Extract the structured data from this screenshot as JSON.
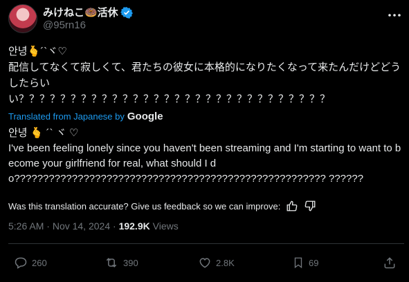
{
  "author": {
    "display_name": "みけねこ🍩活休",
    "handle": "@95rn16"
  },
  "tweet": {
    "original_text": "안녕🫰´`ヾ♡\n配信してなくて寂しくて、君たちの彼女に本格的になりたくなって来たんだけどどうしたらい\nい？？？？？？？？？？？？？？？？？？？？？？？？？？？？？？",
    "translated_label": "Translated from Japanese by",
    "translated_brand": "Google",
    "translated_text": "안녕 🫰 ´` ヾ ♡\nI've been feeling lonely since you haven't been streaming and I'm starting to want to become your girlfriend for real, what should I do?????????????????????????????????????????????????????? ??????",
    "feedback_prompt": "Was this translation accurate? Give us feedback so we can improve:",
    "time": "5:26 AM",
    "date": "Nov 14, 2024",
    "separator": "·",
    "views_count": "192.9K",
    "views_label": "Views"
  },
  "actions": {
    "replies": "260",
    "reposts": "390",
    "likes": "2.8K",
    "bookmarks": "69"
  },
  "colors": {
    "background": "#000000",
    "text": "#e7e9ea",
    "muted": "#71767b",
    "link": "#1d9bf0",
    "divider": "#2f3336"
  },
  "icons": [
    "verified-badge-icon",
    "more-icon",
    "thumbs-up-icon",
    "thumbs-down-icon",
    "reply-icon",
    "repost-icon",
    "like-icon",
    "bookmark-icon",
    "share-icon"
  ]
}
